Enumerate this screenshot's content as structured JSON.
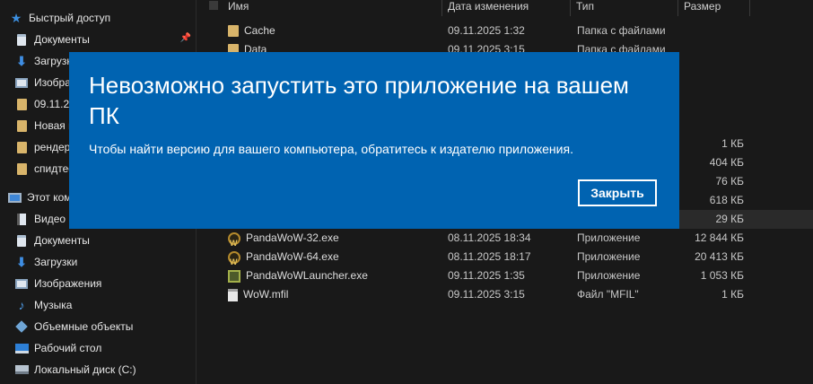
{
  "sidebar": {
    "items": [
      {
        "label": "Быстрый доступ",
        "icon": "star-icon",
        "pinned": false
      },
      {
        "label": "Документы",
        "icon": "documents-icon",
        "pinned": true
      },
      {
        "label": "Загрузки",
        "icon": "downloads-icon",
        "pinned": false
      },
      {
        "label": "Изобра",
        "icon": "pictures-icon",
        "pinned": false
      },
      {
        "label": "09.11.20",
        "icon": "folder-icon",
        "pinned": false
      },
      {
        "label": "Новая п",
        "icon": "folder-icon",
        "pinned": false
      },
      {
        "label": "рендер",
        "icon": "folder-icon",
        "pinned": false
      },
      {
        "label": "спидтес",
        "icon": "folder-icon",
        "pinned": false
      },
      {
        "label": "Этот комп",
        "icon": "this-pc-icon",
        "pinned": false
      },
      {
        "label": "Видео",
        "icon": "videos-icon",
        "pinned": false
      },
      {
        "label": "Документы",
        "icon": "documents-icon",
        "pinned": false
      },
      {
        "label": "Загрузки",
        "icon": "downloads-icon",
        "pinned": false
      },
      {
        "label": "Изображения",
        "icon": "pictures-icon",
        "pinned": false
      },
      {
        "label": "Музыка",
        "icon": "music-icon",
        "pinned": false
      },
      {
        "label": "Объемные объекты",
        "icon": "3d-objects-icon",
        "pinned": false
      },
      {
        "label": "Рабочий стол",
        "icon": "desktop-icon",
        "pinned": false
      },
      {
        "label": "Локальный диск (C:)",
        "icon": "local-disk-icon",
        "pinned": false
      }
    ]
  },
  "columns": {
    "name": "Имя",
    "date": "Дата изменения",
    "type": "Тип",
    "size": "Размер"
  },
  "files": [
    {
      "name": "Cache",
      "date": "09.11.2025 1:32",
      "type": "Папка с файлами",
      "size": "",
      "icon": "folder-icon"
    },
    {
      "name": "Data",
      "date": "09.11.2025 3:15",
      "type": "Папка с файлами",
      "size": "",
      "icon": "folder-icon"
    },
    {
      "name": "",
      "date": "",
      "type": "",
      "size": "1 КБ",
      "icon": ""
    },
    {
      "name": "",
      "date": "",
      "type": "",
      "size": "404 КБ",
      "icon": ""
    },
    {
      "name": "",
      "date": "",
      "type": "",
      "size": "76 КБ",
      "icon": ""
    },
    {
      "name": "",
      "date": "",
      "type": "",
      "size": "618 КБ",
      "icon": ""
    },
    {
      "name": "",
      "date": "",
      "type": "",
      "size": "29 КБ",
      "icon": ""
    },
    {
      "name": "PandaWoW-32.exe",
      "date": "08.11.2025 18:34",
      "type": "Приложение",
      "size": "12 844 КБ",
      "icon": "wow-app-icon"
    },
    {
      "name": "PandaWoW-64.exe",
      "date": "08.11.2025 18:17",
      "type": "Приложение",
      "size": "20 413 КБ",
      "icon": "wow-app-icon"
    },
    {
      "name": "PandaWoWLauncher.exe",
      "date": "09.11.2025 1:35",
      "type": "Приложение",
      "size": "1 053 КБ",
      "icon": "launcher-app-icon"
    },
    {
      "name": "WoW.mfil",
      "date": "09.11.2025 3:15",
      "type": "Файл \"MFIL\"",
      "size": "1 КБ",
      "icon": "file-icon"
    }
  ],
  "dialog": {
    "title": "Невозможно запустить это приложение на вашем ПК",
    "message": "Чтобы найти версию для вашего компьютера, обратитесь к издателю приложения.",
    "close_label": "Закрыть",
    "background": "#0063b1"
  },
  "wow_icon_glyph": "W"
}
